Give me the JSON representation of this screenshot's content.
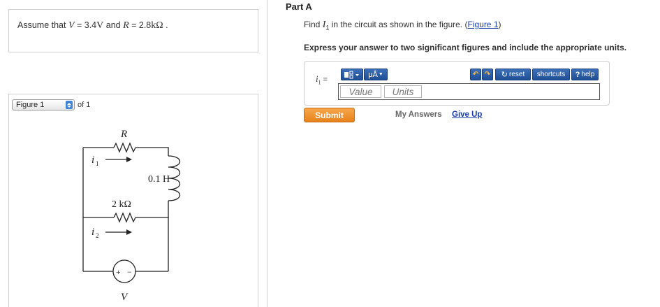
{
  "given": {
    "lead": "Assume that ",
    "var_v": "V",
    "eq_v": " = 3.4",
    "unit_v": "V",
    "and": " and ",
    "var_r": "R",
    "eq_r": " = 2.8",
    "unit_r": "kΩ",
    "end": " ."
  },
  "figure": {
    "select_value": "Figure 1",
    "of_total": "of 1",
    "labels": {
      "r": "R",
      "i1": "i",
      "i1_sub": "1",
      "inductor": "0.1 H",
      "resistor2": "2 kΩ",
      "i2": "i",
      "i2_sub": "2",
      "plus": "+",
      "minus": "−",
      "v": "V"
    }
  },
  "part": {
    "title": "Part A",
    "prompt_lead": "Find ",
    "prompt_var": "I",
    "prompt_sub": "1",
    "prompt_mid": " in the circuit as shown in the figure. (",
    "prompt_link": "Figure 1",
    "prompt_end": ")",
    "instruction": "Express your answer to two significant figures and include the appropriate units."
  },
  "answer": {
    "label_var": "i",
    "label_sub": "1",
    "label_eq": " =",
    "templates_label": "▯▫̲",
    "units_label": "μÅ",
    "undo_label": "↶",
    "redo_label": "↷",
    "reset_label": "reset",
    "shortcuts_label": "shortcuts",
    "help_label": "help",
    "value_placeholder": "Value",
    "units_placeholder": "Units"
  },
  "actions": {
    "submit": "Submit",
    "my_answers": "My Answers",
    "give_up": "Give Up"
  },
  "colors": {
    "toolbar_blue": "#2a5ba5",
    "submit_orange": "#f0902e",
    "link_blue": "#1a3fa8"
  }
}
